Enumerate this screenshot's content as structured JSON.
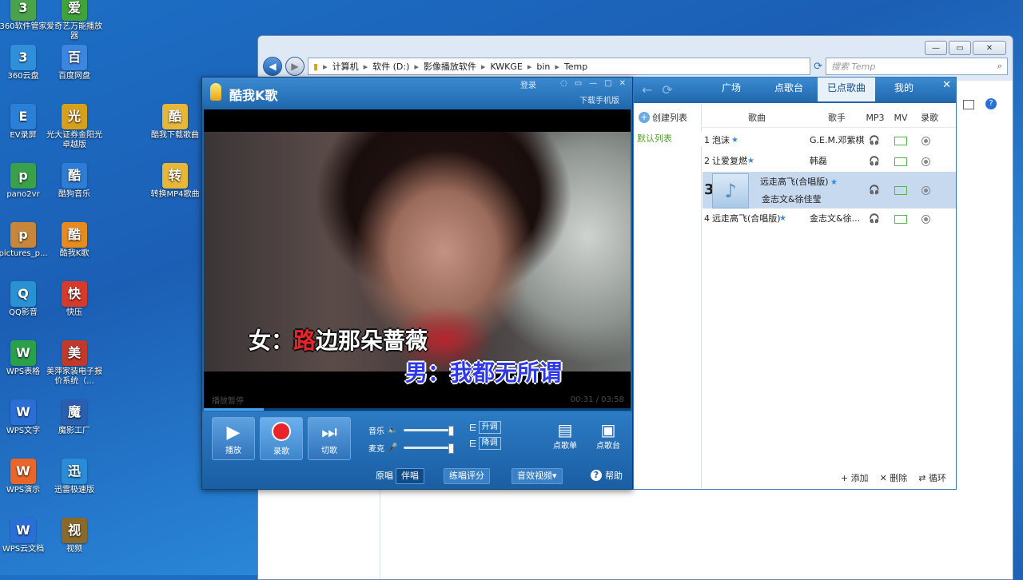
{
  "desktop": {
    "icons": [
      {
        "label": "360软件管家",
        "color": "#4aa34a"
      },
      {
        "label": "爱奇艺万能播放器",
        "color": "#3fa23a"
      },
      {
        "label": "360云盘",
        "color": "#2f8fd8"
      },
      {
        "label": "百度网盘",
        "color": "#3b86e0"
      },
      {
        "label": "EV录屏",
        "color": "#2a7fd6"
      },
      {
        "label": "光大证券金阳光卓越版",
        "color": "#d6a01d"
      },
      {
        "label": "酷我下载歌曲",
        "color": "#e7b73a"
      },
      {
        "label": "pano2vr",
        "color": "#3aa04a"
      },
      {
        "label": "酷狗音乐",
        "color": "#2d7dd6"
      },
      {
        "label": "转换MP4歌曲",
        "color": "#e7b73a"
      },
      {
        "label": "pictures_p...",
        "color": "#c7863a"
      },
      {
        "label": "酷我K歌",
        "color": "#e88b1f"
      },
      {
        "label": "QQ影音",
        "color": "#2a91d4"
      },
      {
        "label": "快压",
        "color": "#d63a2a"
      },
      {
        "label": "WPS表格",
        "color": "#2aa04a"
      },
      {
        "label": "美萍家装电子报价系统（...",
        "color": "#c0392b"
      },
      {
        "label": "WPS文字",
        "color": "#2a6fd6"
      },
      {
        "label": "魔影工厂",
        "color": "#2a5fb0"
      },
      {
        "label": "WPS演示",
        "color": "#e8662a"
      },
      {
        "label": "迅雷极速版",
        "color": "#2a8bd6"
      },
      {
        "label": "WPS云文档",
        "color": "#2a6fd6"
      },
      {
        "label": "视频",
        "color": "#8a6a2a"
      }
    ]
  },
  "explorer": {
    "path": [
      "计算机",
      "软件 (D:)",
      "影像播放软件",
      "KWKGE",
      "bin",
      "Temp"
    ],
    "search_placeholder": "搜索 Temp",
    "window_buttons": {
      "minimize": "—",
      "maximize": "▭",
      "close": "✕"
    }
  },
  "player": {
    "title": "酷我K歌",
    "login": "登录",
    "mobile_download": "下载手机版",
    "lyrics": {
      "female_prefix": "女：",
      "female_sung": "路",
      "female_rest": "边那朵蔷薇",
      "male": "男：我都无所谓"
    },
    "status": "播放暂停",
    "time": "00:31 / 03:58",
    "progress": 0.14,
    "controls": {
      "play": "播放",
      "record": "录歌",
      "next": "切歌",
      "music_label": "音乐",
      "mic_label": "麦克",
      "key_up": "升调",
      "key_down": "降调",
      "song_list": "点歌单",
      "song_stage": "点歌台"
    },
    "music_level": 0.98,
    "mic_level": 0.98,
    "bottom": {
      "original": "原唱",
      "accompany": "伴唱",
      "practice_score": "练唱评分",
      "effects_video": "音效视频▾",
      "help": "帮助"
    }
  },
  "songs": {
    "tabs": [
      "广场",
      "点歌台",
      "已点歌曲",
      "我的"
    ],
    "active_tab": "已点歌曲",
    "create_list": "创建列表",
    "default_list": "默认列表",
    "columns": [
      "歌曲",
      "歌手",
      "MP3",
      "MV",
      "录歌"
    ],
    "rows": [
      {
        "num": "1",
        "title": "泡沫",
        "artist": "G.E.M.邓紫棋"
      },
      {
        "num": "2",
        "title": "让爱复燃",
        "artist": "韩磊"
      },
      {
        "num": "3",
        "title": "远走高飞(合唱版)",
        "artist": "金志文&徐佳莹"
      },
      {
        "num": "4",
        "title": "远走高飞(合唱版)",
        "artist": "金志文&徐..."
      }
    ],
    "footer": {
      "add": "添加",
      "delete": "删除",
      "loop": "循环"
    }
  }
}
